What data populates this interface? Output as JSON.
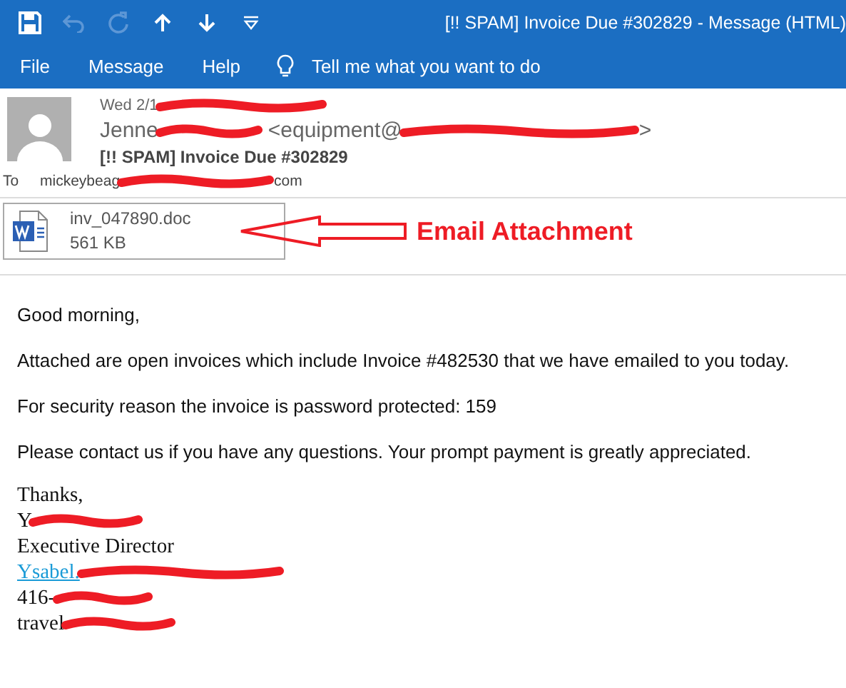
{
  "title_bar": {
    "title": "[!! SPAM]  Invoice Due #302829  -  Message (HTML)",
    "quick_access": [
      {
        "kind": "save",
        "disabled": false
      },
      {
        "kind": "undo",
        "disabled": true
      },
      {
        "kind": "redo",
        "disabled": true
      },
      {
        "kind": "up",
        "disabled": false
      },
      {
        "kind": "down",
        "disabled": false
      },
      {
        "kind": "customize",
        "disabled": false
      }
    ]
  },
  "menu": [
    {
      "label": "File"
    },
    {
      "label": "Message"
    },
    {
      "label": "Help"
    }
  ],
  "tell_me": "Tell me what you want to do",
  "header": {
    "date": {
      "text": "Wed 2/1",
      "redacted": true
    },
    "sender_name": {
      "text": "Jenne",
      "redacted": true
    },
    "sender_address": {
      "text": "<equipment@",
      "redacted": true
    },
    "sender_address_end": ">",
    "subject": "[!! SPAM]  Invoice Due #302829",
    "to_label": "To",
    "to": {
      "text": "mickeybeag",
      "redacted": true
    },
    "to_end": "com"
  },
  "attachment": {
    "name": "inv_047890.doc",
    "size": "561 KB"
  },
  "annotation": {
    "label": "Email Attachment"
  },
  "body": {
    "paragraphs": [
      "Good morning,",
      "Attached are open invoices which include Invoice #482530 that we have emailed to you today.",
      "For security reason the invoice is password protected: 159",
      "Please contact us if you have any questions. Your prompt payment is greatly appreciated."
    ]
  },
  "signature": [
    {
      "kind": "text",
      "text": "Thanks,",
      "redacted": false
    },
    {
      "kind": "text",
      "text": "Y",
      "redacted": true
    },
    {
      "kind": "text",
      "text": "Executive Director",
      "redacted": false
    },
    {
      "kind": "link",
      "text": "Ysabel.",
      "redacted": true
    },
    {
      "kind": "text",
      "text": "416-",
      "redacted": true
    },
    {
      "kind": "text",
      "text": "travel",
      "redacted": true
    }
  ]
}
